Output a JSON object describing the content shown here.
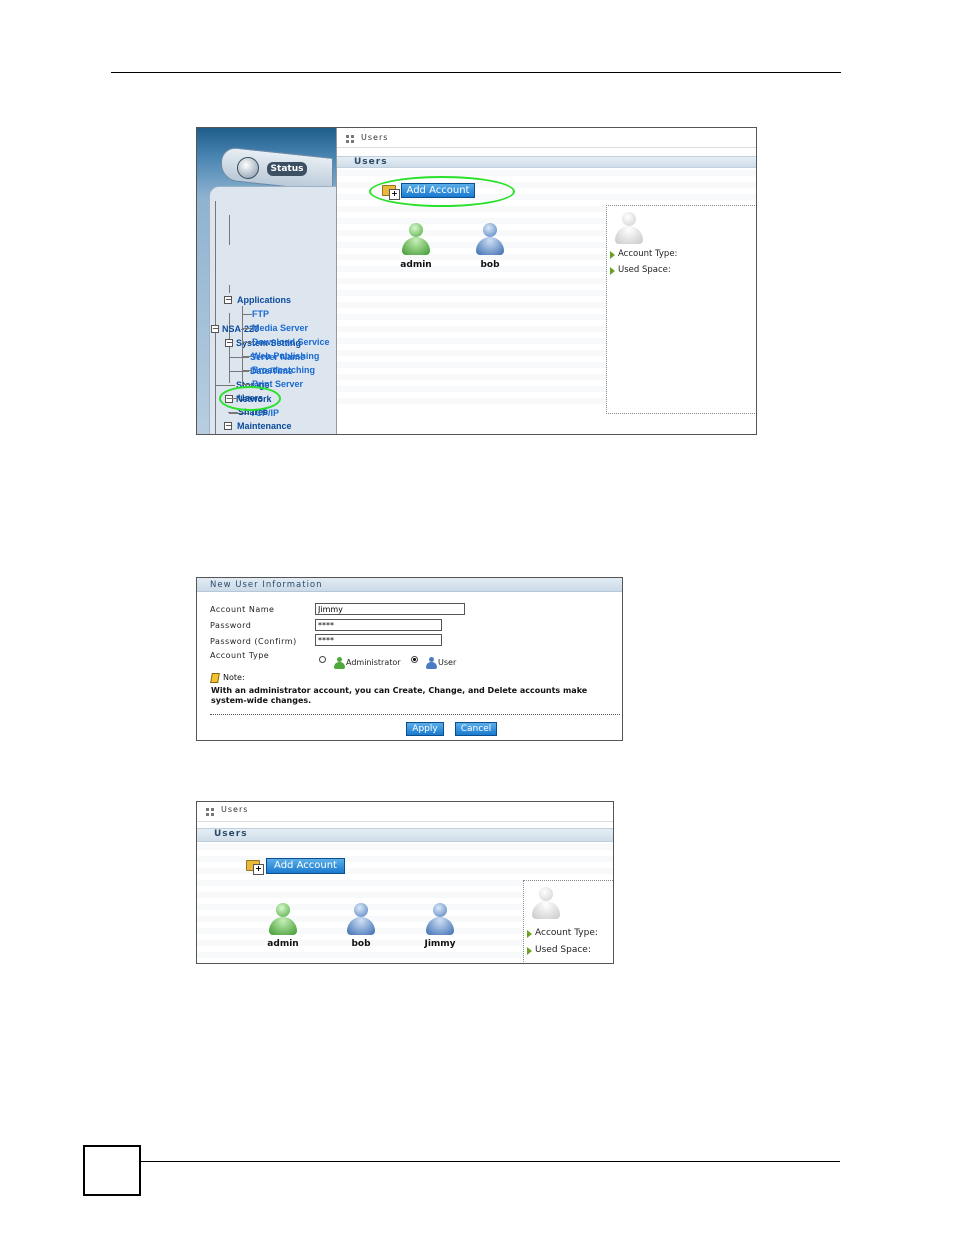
{
  "screenshot1": {
    "sidebar": {
      "status_tab": "Status",
      "tree": [
        {
          "label": "NSA-220"
        },
        {
          "label": "System Setting"
        },
        {
          "label": "Server Name"
        },
        {
          "label": "Date/Time"
        },
        {
          "label": "Storage"
        },
        {
          "label": "Network"
        },
        {
          "label": "TCP/IP"
        },
        {
          "label": "Applications"
        },
        {
          "label": "FTP"
        },
        {
          "label": "Media Server"
        },
        {
          "label": "Download Service"
        },
        {
          "label": "Web Publishing"
        },
        {
          "label": "Broadcatching"
        },
        {
          "label": "Print Server"
        },
        {
          "label": "Users"
        },
        {
          "label": "Shares"
        },
        {
          "label": "Maintenance"
        }
      ]
    },
    "main": {
      "breadcrumb": "Users",
      "section_title": "Users",
      "add_button": "Add Account",
      "users": [
        "admin",
        "bob"
      ],
      "info_panel": {
        "account_type": "Account Type:",
        "used_space": "Used Space:"
      }
    }
  },
  "screenshot2": {
    "title": "New User Information",
    "fields": {
      "account_name_label": "Account Name",
      "account_name_value": "Jimmy",
      "password_label": "Password",
      "password_value": "****",
      "confirm_label": "Password (Confirm)",
      "confirm_value": "****",
      "account_type_label": "Account Type",
      "type_admin": "Administrator",
      "type_user": "User"
    },
    "note_label": "Note:",
    "note_line1": "With an administrator account, you can Create, Change, and Delete accounts make",
    "note_line2": "system-wide changes.",
    "apply": "Apply",
    "cancel": "Cancel"
  },
  "screenshot3": {
    "breadcrumb": "Users",
    "section_title": "Users",
    "add_button": "Add Account",
    "users": [
      "admin",
      "bob",
      "Jimmy"
    ],
    "info_panel": {
      "account_type": "Account Type:",
      "used_space": "Used Space:"
    }
  }
}
